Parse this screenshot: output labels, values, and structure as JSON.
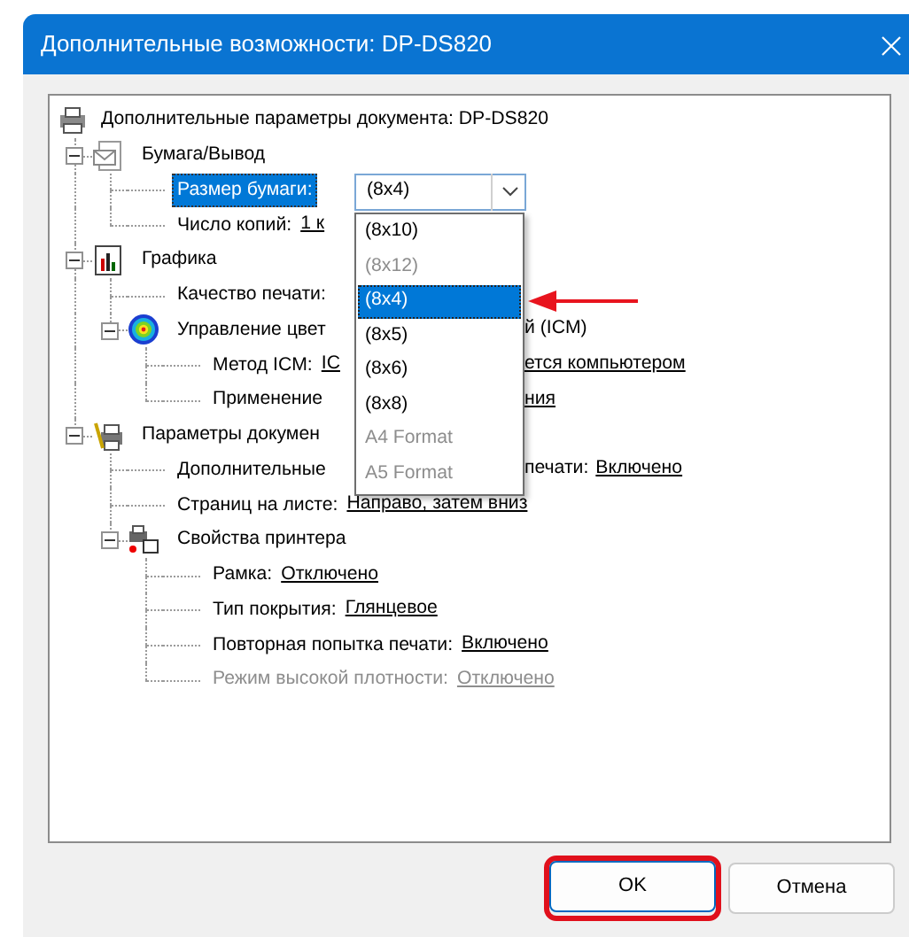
{
  "window": {
    "title": "Дополнительные возможности: DP-DS820"
  },
  "tree": {
    "label": "Дополнительные параметры документа: DP-DS820",
    "selected": false,
    "children": [
      {
        "label": "Бумага/Вывод",
        "selected": false,
        "expanded": true,
        "children": [
          {
            "kind": "combo",
            "label": "Размер бумаги:",
            "selected": true,
            "combo": {
              "value": "(8x4)",
              "open": true,
              "options": [
                {
                  "label": "(8x10)",
                  "selected": false,
                  "disabled": false,
                  "marked": false
                },
                {
                  "label": "(8x12)",
                  "selected": false,
                  "disabled": true,
                  "marked": false
                },
                {
                  "label": "(8x4)",
                  "selected": true,
                  "disabled": false,
                  "marked": true
                },
                {
                  "label": "(8x5)",
                  "selected": false,
                  "disabled": false,
                  "marked": false
                },
                {
                  "label": "(8x6)",
                  "selected": false,
                  "disabled": false,
                  "marked": false
                },
                {
                  "label": "(8x8)",
                  "selected": false,
                  "disabled": false,
                  "marked": false
                },
                {
                  "label": "A4 Format",
                  "selected": false,
                  "disabled": true,
                  "marked": false
                },
                {
                  "label": "A5 Format",
                  "selected": false,
                  "disabled": true,
                  "marked": false
                }
              ]
            }
          },
          {
            "kind": "setting",
            "label": "Число копий:",
            "value": "1 к",
            "selected": false
          }
        ]
      },
      {
        "label": "Графика",
        "selected": false,
        "expanded": true,
        "children": [
          {
            "kind": "setting",
            "label": "Качество печати:",
            "selected": false
          },
          {
            "label": "Управление цвет",
            "selected": false,
            "expanded": true,
            "right_of_list": {
              "label": "й (ICM)"
            },
            "children": [
              {
                "kind": "setting",
                "label": "Метод ICM:",
                "value": "IC",
                "selected": false,
                "right_of_list": {
                  "value": "ется компьютером"
                }
              },
              {
                "kind": "setting",
                "label": "Применение",
                "selected": false,
                "right_of_list": {
                  "value": "ния"
                }
              }
            ]
          }
        ]
      },
      {
        "label": "Параметры докумен",
        "selected": false,
        "expanded": true,
        "children": [
          {
            "kind": "setting",
            "label": "Дополнительные",
            "selected": false,
            "right_of_list": {
              "label": "печати:",
              "value": "Включено"
            }
          },
          {
            "kind": "setting",
            "label": "Страниц на листе:",
            "value": "Направо, затем вниз",
            "selected": false
          },
          {
            "label": "Свойства принтера",
            "selected": false,
            "expanded": true,
            "children": [
              {
                "kind": "setting",
                "label": "Рамка:",
                "value": "Отключено",
                "selected": false
              },
              {
                "kind": "setting",
                "label": "Тип покрытия:",
                "value": "Глянцевое",
                "selected": false
              },
              {
                "kind": "setting",
                "label": "Повторная попытка печати:",
                "value": "Включено",
                "selected": false
              },
              {
                "kind": "setting",
                "label": "Режим высокой плотности:",
                "value": "Отключено",
                "selected": false,
                "disabled": true
              }
            ]
          }
        ]
      }
    ]
  },
  "buttons": [
    {
      "label": "OK",
      "default": true,
      "marked": true
    },
    {
      "label": "Отмена",
      "default": false,
      "marked": false
    }
  ]
}
